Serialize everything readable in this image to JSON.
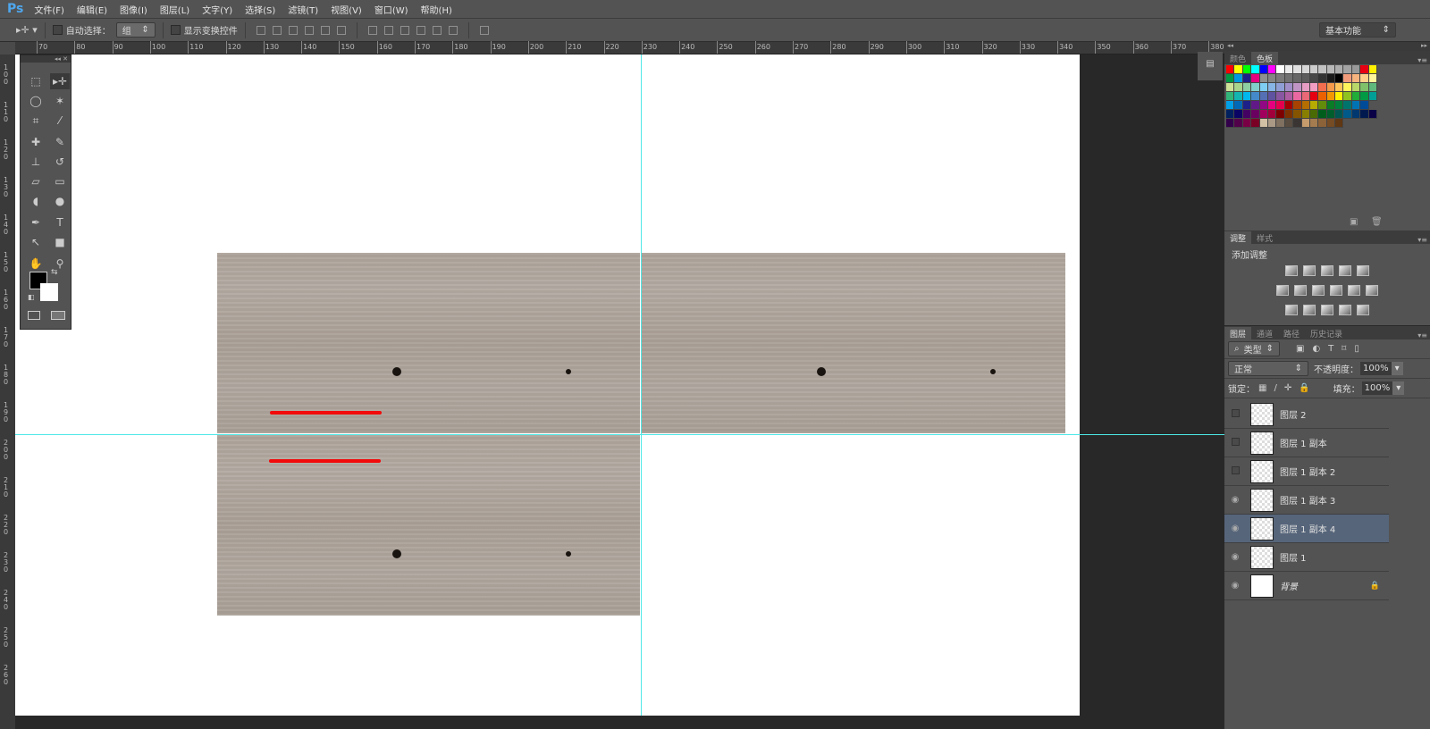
{
  "app": {
    "logo": "Ps"
  },
  "menu": [
    "文件(F)",
    "编辑(E)",
    "图像(I)",
    "图层(L)",
    "文字(Y)",
    "选择(S)",
    "滤镜(T)",
    "视图(V)",
    "窗口(W)",
    "帮助(H)"
  ],
  "options": {
    "auto_select_label": "自动选择：",
    "auto_select_value": "组",
    "show_transform_label": "显示变换控件",
    "workspace": "基本功能"
  },
  "ruler": {
    "h": [
      "70",
      "80",
      "90",
      "100",
      "110",
      "120",
      "130",
      "140",
      "150",
      "160",
      "170",
      "180",
      "190",
      "200",
      "210",
      "220",
      "230",
      "240",
      "250",
      "260",
      "270",
      "280",
      "290",
      "300",
      "310",
      "320",
      "330",
      "340",
      "350",
      "360",
      "370",
      "380"
    ],
    "v": [
      "100",
      "110",
      "120",
      "130",
      "140",
      "150",
      "160",
      "170",
      "180",
      "190",
      "200",
      "210",
      "220",
      "230",
      "240",
      "250",
      "260"
    ]
  },
  "color_panel": {
    "tabs": [
      "颜色",
      "色板"
    ],
    "active": 1,
    "swatches": [
      [
        "#ff0000",
        "#ffff00",
        "#00ff00",
        "#00ffff",
        "#0000ff",
        "#ff00ff",
        "#ffffff",
        "#ebebeb",
        "#e0e0e0",
        "#d6d6d6",
        "#cccccc",
        "#c2c2c2",
        "#b8b8b8",
        "#adadad",
        "#a3a3a3",
        "#999999",
        "#e60012",
        "#fff100"
      ],
      [
        "#009944",
        "#0099dd",
        "#1d2088",
        "#e4007f",
        "#8f8f8f",
        "#858585",
        "#7a7a7a",
        "#707070",
        "#666666",
        "#5c5c5c",
        "#474747",
        "#333333",
        "#1a1a1a",
        "#000000",
        "#f19b7a",
        "#f8b47e",
        "#ffd08a",
        "#fff799"
      ],
      [
        "#cde297",
        "#a8d48c",
        "#8dcea3",
        "#82cfc9",
        "#7ecef4",
        "#87b5e5",
        "#8f9fd5",
        "#a08fc8",
        "#c095c5",
        "#e69dc4",
        "#f19ec2",
        "#f36e4f",
        "#f39a4b",
        "#fcc55c",
        "#fff45c",
        "#b8d86a",
        "#7ec16a",
        "#5fb97c"
      ],
      [
        "#31b579",
        "#13b5b1",
        "#00b7ee",
        "#448aca",
        "#556fb5",
        "#5f52a0",
        "#8957a1",
        "#ad5da1",
        "#ea68a2",
        "#eb6877",
        "#e60012",
        "#eb6100",
        "#f39800",
        "#fff100",
        "#8fc31f",
        "#22ac38",
        "#009944",
        "#009e96"
      ],
      [
        "#00a0e9",
        "#0068b7",
        "#1d2088",
        "#601986",
        "#920783",
        "#e4007f",
        "#e5004f",
        "#a40000",
        "#a84200",
        "#b36d00",
        "#b7aa00",
        "#638c0b",
        "#097c25",
        "#007e3b",
        "#00736d",
        "#0073b5",
        "#004b97"
      ],
      [
        "#00205e",
        "#0a0465",
        "#440062",
        "#6a005f",
        "#a1005d",
        "#a2003a",
        "#7d0000",
        "#7e3100",
        "#855400",
        "#887f00",
        "#4a6a04",
        "#005d1c",
        "#005e2c",
        "#005752",
        "#005a89",
        "#00386f",
        "#001a4f",
        "#0a0046"
      ],
      [
        "#32004a",
        "#52004a",
        "#7a0046",
        "#7a0025",
        "#d3c1a5",
        "#aa9985",
        "#7f7060",
        "#594c40",
        "#3a3532",
        "#c69c6d",
        "#a57c4f",
        "#8c6239",
        "#754c24",
        "#603813"
      ]
    ]
  },
  "adjust_panel": {
    "tabs": [
      "调整",
      "样式"
    ],
    "title": "添加调整"
  },
  "layers_panel": {
    "tabs": [
      "图层",
      "通道",
      "路径",
      "历史记录"
    ],
    "filter": "类型",
    "blend_mode": "正常",
    "opacity_label": "不透明度：",
    "opacity": "100%",
    "lock_label": "锁定：",
    "fill_label": "填充：",
    "fill": "100%",
    "layers": [
      {
        "name": "图层 2",
        "visible": false,
        "selected": false
      },
      {
        "name": "图层 1 副本",
        "visible": false,
        "selected": false
      },
      {
        "name": "图层 1 副本 2",
        "visible": false,
        "selected": false
      },
      {
        "name": "图层 1 副本 3",
        "visible": true,
        "selected": false
      },
      {
        "name": "图层 1 副本 4",
        "visible": true,
        "selected": true
      },
      {
        "name": "图层 1",
        "visible": true,
        "selected": false
      },
      {
        "name": "背景",
        "visible": true,
        "selected": false,
        "locked": true
      }
    ]
  }
}
